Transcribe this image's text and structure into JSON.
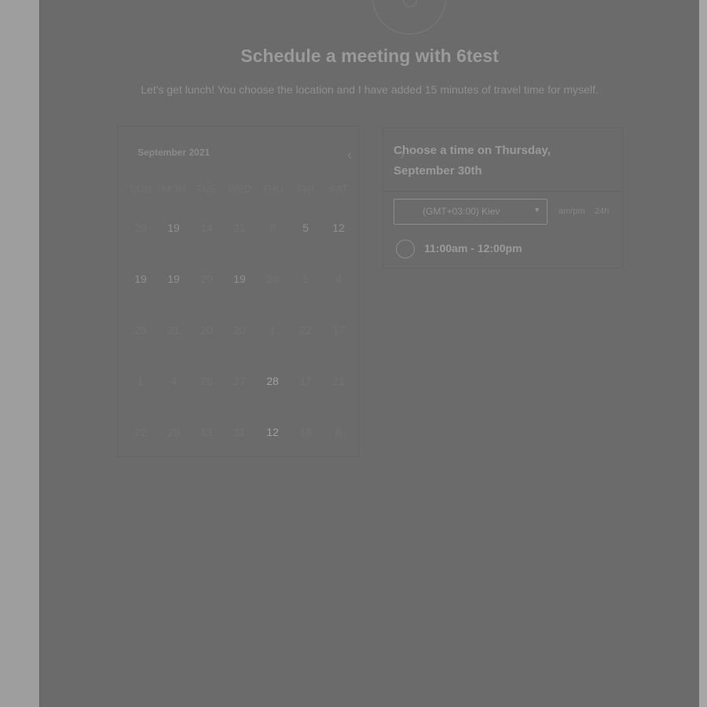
{
  "header": {
    "title": "Schedule a meeting with 6test",
    "subtitle": "Let's get lunch! You choose the location and I have added 15 minutes of travel time for myself."
  },
  "calendar": {
    "month_label": "September 2021",
    "prev_icon": "chevron-left-icon",
    "next_icon": "chevron-right-icon",
    "weekdays": [
      "SUN",
      "MON",
      "TUE",
      "WED",
      "THU",
      "FRI",
      "SAT"
    ],
    "weeks": [
      [
        {
          "label": "29",
          "state": "disabled"
        },
        {
          "label": "19",
          "state": "available"
        },
        {
          "label": "14",
          "state": "disabled"
        },
        {
          "label": "21",
          "state": "disabled"
        },
        {
          "label": "8",
          "state": "disabled"
        },
        {
          "label": "5",
          "state": "available"
        },
        {
          "label": "12",
          "state": "available"
        }
      ],
      [
        {
          "label": "19",
          "state": "available"
        },
        {
          "label": "19",
          "state": "available"
        },
        {
          "label": "20",
          "state": "disabled"
        },
        {
          "label": "19",
          "state": "available"
        },
        {
          "label": "20",
          "state": "disabled"
        },
        {
          "label": "1",
          "state": "disabled"
        },
        {
          "label": "4",
          "state": "disabled"
        }
      ],
      [
        {
          "label": "25",
          "state": "disabled"
        },
        {
          "label": "21",
          "state": "disabled"
        },
        {
          "label": "20",
          "state": "disabled"
        },
        {
          "label": "20",
          "state": "disabled"
        },
        {
          "label": "1",
          "state": "disabled"
        },
        {
          "label": "22",
          "state": "disabled"
        },
        {
          "label": "17",
          "state": "disabled"
        }
      ],
      [
        {
          "label": "1",
          "state": "disabled"
        },
        {
          "label": "4",
          "state": "disabled"
        },
        {
          "label": "26",
          "state": "disabled"
        },
        {
          "label": "27",
          "state": "disabled"
        },
        {
          "label": "28",
          "state": "selected"
        },
        {
          "label": "17",
          "state": "disabled"
        },
        {
          "label": "21",
          "state": "disabled"
        }
      ],
      [
        {
          "label": "22",
          "state": "disabled"
        },
        {
          "label": "28",
          "state": "disabled"
        },
        {
          "label": "13",
          "state": "disabled"
        },
        {
          "label": "11",
          "state": "disabled"
        },
        {
          "label": "12",
          "state": "selected"
        },
        {
          "label": "18",
          "state": "disabled"
        },
        {
          "label": "8",
          "state": "disabled"
        }
      ]
    ]
  },
  "times": {
    "heading": "Choose a time on Thursday, September 30th",
    "timezone": "(GMT+03:00) Kiev",
    "format_ampm": "am/pm",
    "format_24h": "24h",
    "slot_label": "11:00am - 12:00pm"
  },
  "colors": {
    "overlay_bg": "#6b6b6b",
    "page_bg": "#9e9e9e"
  }
}
